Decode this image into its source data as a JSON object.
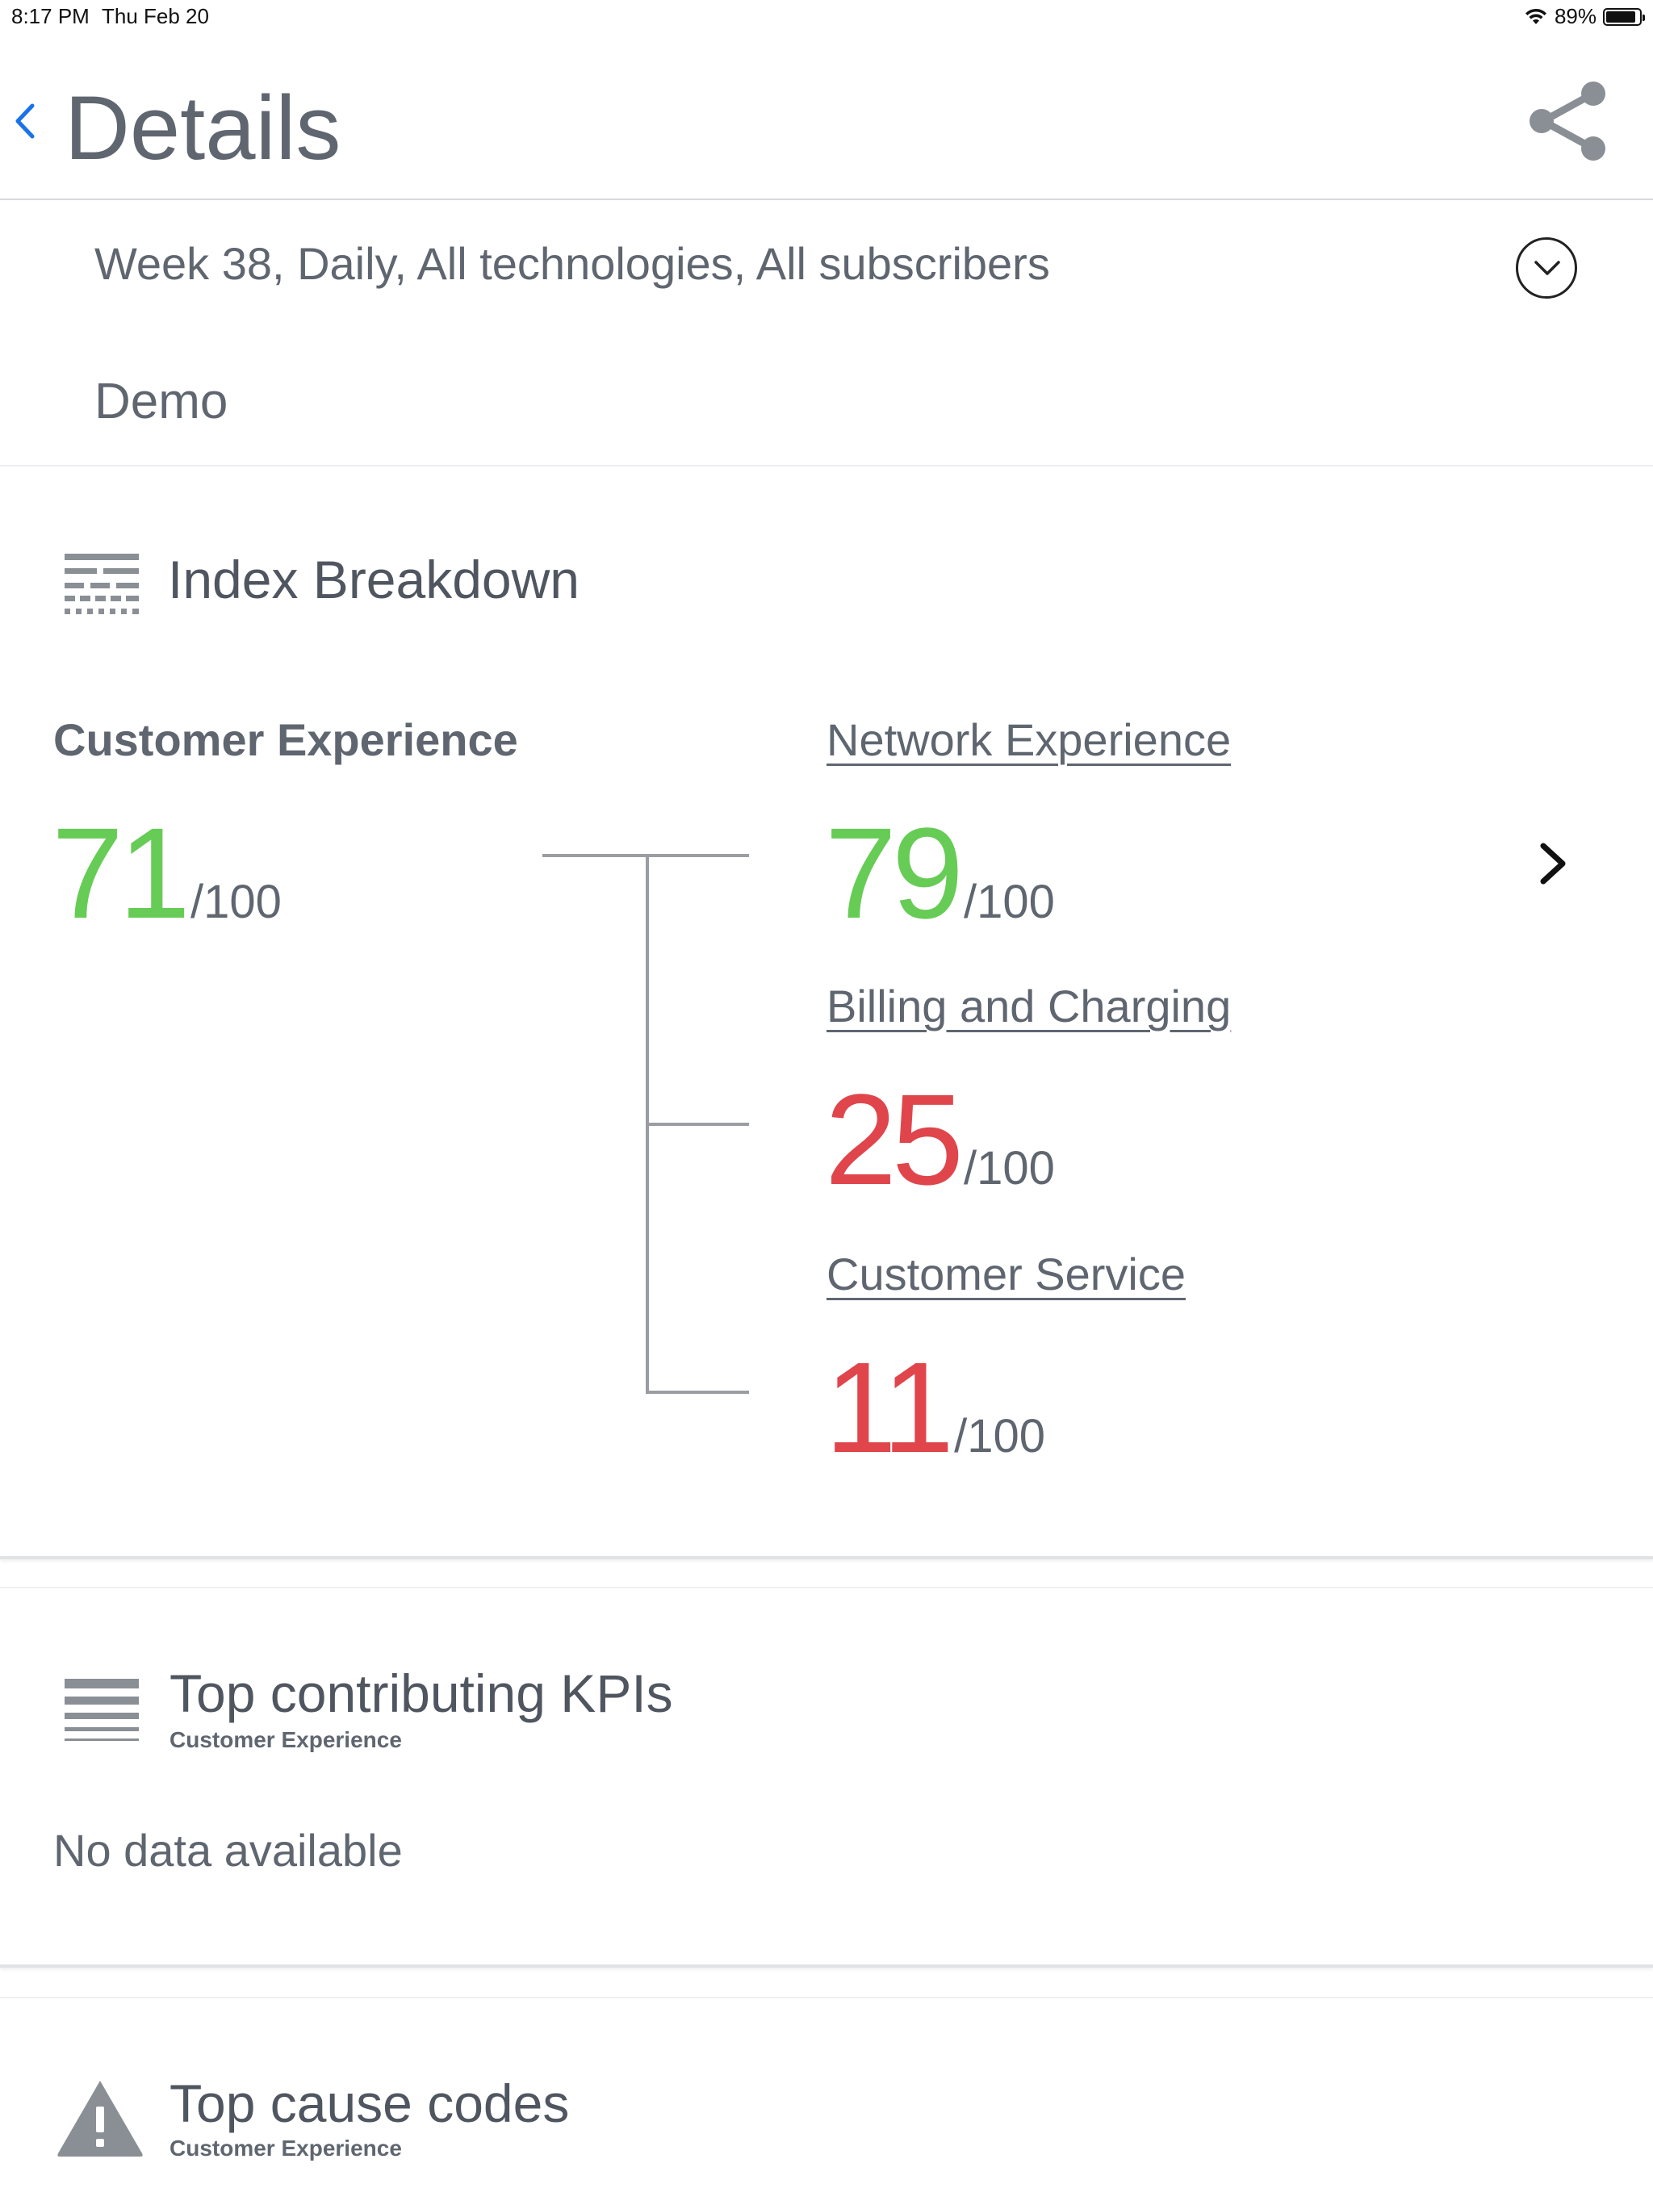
{
  "status_bar": {
    "time": "8:17 PM",
    "date": "Thu Feb 20",
    "battery": "89%",
    "battery_level": 0.89
  },
  "nav": {
    "back_icon": "chevron-left-icon",
    "title": "Details",
    "share_icon": "share-icon"
  },
  "filter": {
    "summary": "Week 38, Daily, All technologies, All subscribers",
    "toggle_icon": "chevron-down-circle-icon",
    "profile": "Demo"
  },
  "index_breakdown": {
    "title": "Index Breakdown",
    "main": {
      "label": "Customer Experience",
      "score": "71",
      "max": "/100",
      "status": "good"
    },
    "children": [
      {
        "label": "Network Experience",
        "score": "79",
        "max": "/100",
        "status": "good"
      },
      {
        "label": "Billing and Charging",
        "score": "25",
        "max": "/100",
        "status": "bad"
      },
      {
        "label": "Customer Service",
        "score": "11",
        "max": "/100",
        "status": "bad"
      }
    ],
    "colors": {
      "good": "#66cc55",
      "bad": "#e0454c"
    }
  },
  "top_kpis": {
    "title": "Top contributing KPIs",
    "subtitle": "Customer Experience",
    "empty_text": "No data available"
  },
  "top_cause_codes": {
    "title": "Top cause codes",
    "subtitle": "Customer Experience"
  }
}
